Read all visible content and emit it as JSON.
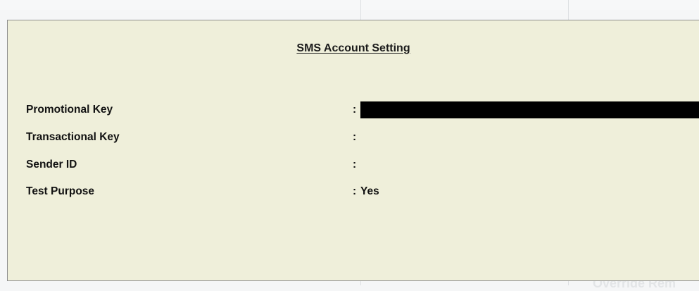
{
  "form": {
    "title": "SMS Account Setting",
    "fields": [
      {
        "label": "Promotional Key",
        "separator": ":",
        "value": "",
        "redacted": true
      },
      {
        "label": "Transactional Key",
        "separator": ":",
        "value": ""
      },
      {
        "label": "Sender ID",
        "separator": ":",
        "value": ""
      },
      {
        "label": "Test Purpose",
        "separator": ":",
        "value": "Yes"
      }
    ]
  },
  "background": {
    "ghost_text": "Override Rem"
  },
  "colors": {
    "panel_background": "#efefda",
    "panel_border": "#8e8e8e",
    "redaction": "#000000",
    "text": "#111111"
  }
}
